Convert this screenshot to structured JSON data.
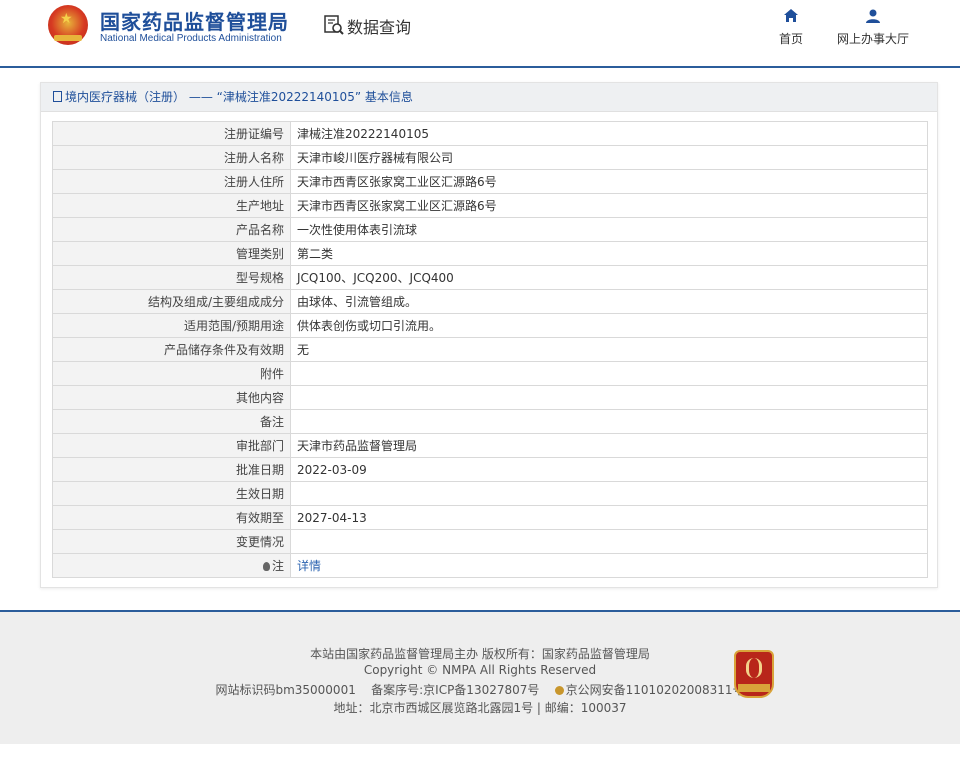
{
  "header": {
    "brand_cn": "国家药品监督管理局",
    "brand_en": "National Medical Products Administration",
    "page_title": "数据查询",
    "nav": [
      {
        "label": "首页",
        "icon": "home-icon"
      },
      {
        "label": "网上办事大厅",
        "icon": "user-icon"
      }
    ]
  },
  "card": {
    "title": "境内医疗器械（注册） —— “津械注准20222140105” 基本信息",
    "rows": [
      {
        "key": "注册证编号",
        "value": "津械注准20222140105"
      },
      {
        "key": "注册人名称",
        "value": "天津市峻川医疗器械有限公司"
      },
      {
        "key": "注册人住所",
        "value": "天津市西青区张家窝工业区汇源路6号"
      },
      {
        "key": "生产地址",
        "value": "天津市西青区张家窝工业区汇源路6号"
      },
      {
        "key": "产品名称",
        "value": "一次性使用体表引流球"
      },
      {
        "key": "管理类别",
        "value": "第二类"
      },
      {
        "key": "型号规格",
        "value": "JCQ100、JCQ200、JCQ400"
      },
      {
        "key": "结构及组成/主要组成成分",
        "value": "由球体、引流管组成。"
      },
      {
        "key": "适用范围/预期用途",
        "value": "供体表创伤或切口引流用。"
      },
      {
        "key": "产品储存条件及有效期",
        "value": "无"
      },
      {
        "key": "附件",
        "value": ""
      },
      {
        "key": "其他内容",
        "value": ""
      },
      {
        "key": "备注",
        "value": ""
      },
      {
        "key": "审批部门",
        "value": "天津市药品监督管理局"
      },
      {
        "key": "批准日期",
        "value": "2022-03-09"
      },
      {
        "key": "生效日期",
        "value": ""
      },
      {
        "key": "有效期至",
        "value": "2027-04-13"
      },
      {
        "key": "变更情况",
        "value": ""
      }
    ],
    "note_label": "注",
    "note_link": "详情"
  },
  "footer": {
    "line1": "本站由国家药品监督管理局主办 版权所有：国家药品监督管理局",
    "line2": "Copyright © NMPA All Rights Reserved",
    "site_id": "网站标识码bm35000001",
    "icp": "备案序号:京ICP备13027807号",
    "police": "京公网安备11010202008311号",
    "line4": "地址：北京市西城区展览路北露园1号 | 邮编：100037"
  }
}
